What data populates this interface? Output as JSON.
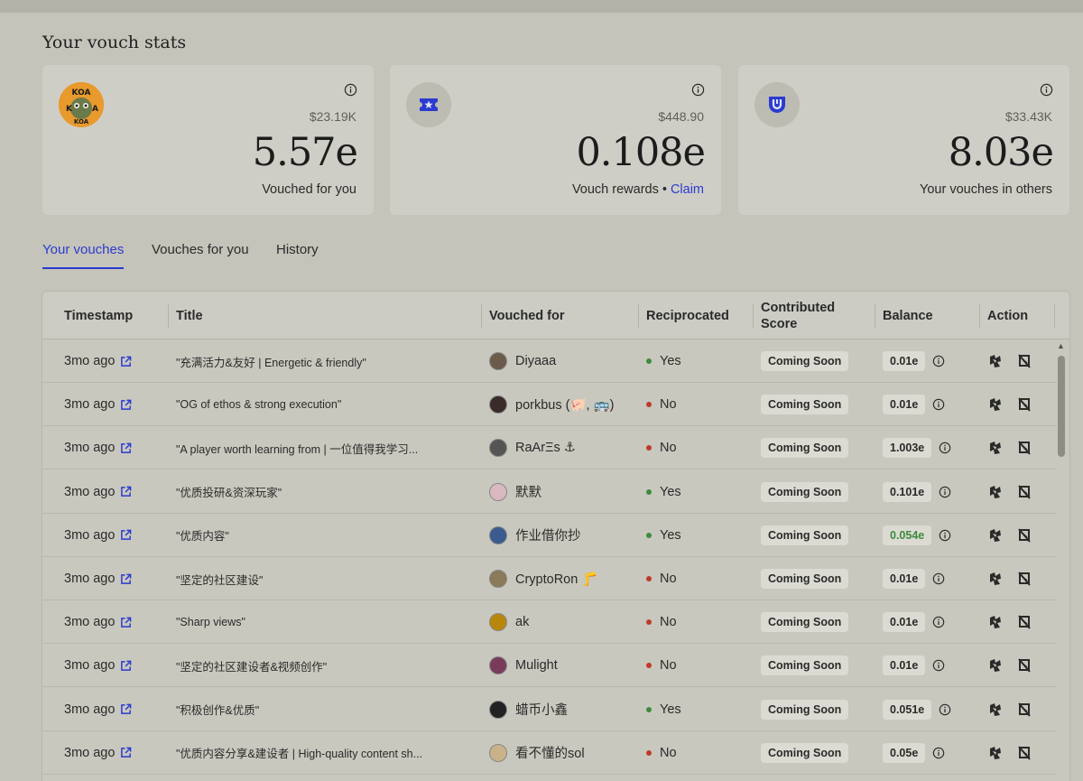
{
  "section_title": "Your vouch stats",
  "cards": [
    {
      "usd": "$23.19K",
      "value": "5.57e",
      "label": "Vouched for you",
      "icon": "koa-avatar"
    },
    {
      "usd": "$448.90",
      "value": "0.108e",
      "label": "Vouch rewards",
      "claim": "Claim",
      "separator": "•",
      "icon": "ticket-star-icon"
    },
    {
      "usd": "$33.43K",
      "value": "8.03e",
      "label": "Your vouches in others",
      "icon": "ethos-shield-icon"
    }
  ],
  "tabs": [
    "Your vouches",
    "Vouches for you",
    "History"
  ],
  "active_tab": "Your vouches",
  "columns": [
    "Timestamp",
    "Title",
    "Vouched for",
    "Reciprocated",
    "Contributed Score",
    "Balance",
    "Action"
  ],
  "rows": [
    {
      "timestamp": "3mo ago",
      "title": "\"充满活力&友好 | Energetic & friendly\"",
      "name": "Diyaaa",
      "reciprocated": "Yes",
      "score": "Coming Soon",
      "balance": "0.01e"
    },
    {
      "timestamp": "3mo ago",
      "title": "\"OG of ethos & strong execution\"",
      "name": "porkbus (🐖, 🚌)",
      "reciprocated": "No",
      "score": "Coming Soon",
      "balance": "0.01e"
    },
    {
      "timestamp": "3mo ago",
      "title": "\"A player worth learning from | 一位值得我学习...",
      "name": "RaArΞs ⚓",
      "reciprocated": "No",
      "score": "Coming Soon",
      "balance": "1.003e"
    },
    {
      "timestamp": "3mo ago",
      "title": "\"优质投研&资深玩家\"",
      "name": "默默",
      "reciprocated": "Yes",
      "score": "Coming Soon",
      "balance": "0.101e"
    },
    {
      "timestamp": "3mo ago",
      "title": "\"优质内容\"",
      "name": "作业借你抄",
      "reciprocated": "Yes",
      "score": "Coming Soon",
      "balance": "0.054e",
      "balance_color": "green"
    },
    {
      "timestamp": "3mo ago",
      "title": "\"坚定的社区建设\"",
      "name": "CryptoRon 🦵",
      "reciprocated": "No",
      "score": "Coming Soon",
      "balance": "0.01e"
    },
    {
      "timestamp": "3mo ago",
      "title": "\"Sharp views\"",
      "name": "ak",
      "reciprocated": "No",
      "score": "Coming Soon",
      "balance": "0.01e"
    },
    {
      "timestamp": "3mo ago",
      "title": "\"坚定的社区建设者&视频创作\"",
      "name": "Mulight",
      "reciprocated": "No",
      "score": "Coming Soon",
      "balance": "0.01e"
    },
    {
      "timestamp": "3mo ago",
      "title": "\"积极创作&优质\"",
      "name": "蜡币小鑫",
      "reciprocated": "Yes",
      "score": "Coming Soon",
      "balance": "0.051e"
    },
    {
      "timestamp": "3mo ago",
      "title": "\"优质内容分享&建设者 | High-quality content sh...",
      "name": "看不懂的sol",
      "reciprocated": "No",
      "score": "Coming Soon",
      "balance": "0.05e"
    }
  ],
  "colors": {
    "accent": "#2b3bcf",
    "yes": "#3e8a3e",
    "no": "#c0392b",
    "green_balance": "#3e8a3e"
  }
}
